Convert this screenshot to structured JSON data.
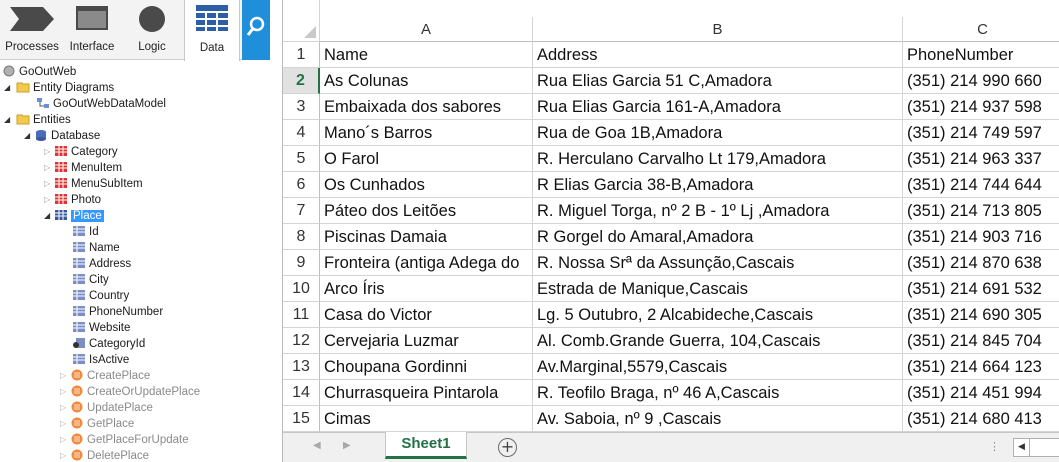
{
  "toolbar": {
    "processes": "Processes",
    "interface": "Interface",
    "logic": "Logic",
    "data": "Data"
  },
  "tree": {
    "root": "GoOutWeb",
    "entity_diagrams": "Entity Diagrams",
    "data_model": "GoOutWebDataModel",
    "entities": "Entities",
    "database": "Database",
    "tables": [
      "Category",
      "MenuItem",
      "MenuSubItem",
      "Photo",
      "Place"
    ],
    "attributes": [
      "Id",
      "Name",
      "Address",
      "City",
      "Country",
      "PhoneNumber",
      "Website",
      "CategoryId",
      "IsActive"
    ],
    "actions": [
      "CreatePlace",
      "CreateOrUpdatePlace",
      "UpdatePlace",
      "GetPlace",
      "GetPlaceForUpdate",
      "DeletePlace"
    ]
  },
  "sheet": {
    "columns": [
      "A",
      "B",
      "C"
    ],
    "row_numbers": [
      "1",
      "2",
      "3",
      "4",
      "5",
      "6",
      "7",
      "8",
      "9",
      "10",
      "11",
      "12",
      "13",
      "14",
      "15"
    ],
    "active_row": "2",
    "rows": [
      [
        "Name",
        "Address",
        "PhoneNumber"
      ],
      [
        "As Colunas",
        "Rua Elias Garcia 51 C,Amadora",
        "(351) 214 990 660"
      ],
      [
        "Embaixada dos sabores",
        "Rua Elias Garcia 161-A,Amadora",
        "(351) 214 937 598"
      ],
      [
        "Mano´s Barros",
        "Rua de Goa 1B,Amadora",
        "(351) 214 749 597"
      ],
      [
        "O Farol",
        "R. Herculano Carvalho Lt 179,Amadora",
        "(351) 214 963 337"
      ],
      [
        "Os Cunhados",
        "R Elias Garcia 38-B,Amadora",
        "(351) 214 744 644"
      ],
      [
        "Páteo dos Leitões",
        "R. Miguel Torga, nº 2 B - 1º Lj ,Amadora",
        "(351) 214 713 805"
      ],
      [
        "Piscinas Damaia",
        "R Gorgel do Amaral,Amadora",
        "(351) 214 903 716"
      ],
      [
        "Fronteira (antiga Adega do",
        "R. Nossa Srª da Assunção,Cascais",
        "(351) 214 870 638"
      ],
      [
        "Arco Íris",
        "Estrada de Manique,Cascais",
        "(351) 214 691 532"
      ],
      [
        "Casa do Victor",
        "Lg. 5 Outubro, 2  Alcabideche,Cascais",
        "(351) 214 690 305"
      ],
      [
        "Cervejaria Luzmar",
        "Al. Comb.Grande Guerra, 104,Cascais",
        "(351) 214 845 704"
      ],
      [
        "Choupana Gordinni",
        "Av.Marginal,5579,Cascais",
        "(351) 214 664 123"
      ],
      [
        "Churrasqueira Pintarola",
        "R. Teofilo Braga, nº 46 A,Cascais",
        "(351) 214 451 994"
      ],
      [
        "Cimas",
        "Av. Saboia, nº 9  ,Cascais",
        "(351) 214 680 413"
      ]
    ],
    "sheet_tab": "Sheet1",
    "add_sheet": "+"
  },
  "colors": {
    "accent": "#217346",
    "search": "#1e8fd8",
    "selection": "#3399ff"
  },
  "icons": {
    "processes": "chevron-shape-icon",
    "interface": "window-icon",
    "logic": "circle-icon",
    "data": "table-grid-icon",
    "search": "magnifier-icon"
  }
}
